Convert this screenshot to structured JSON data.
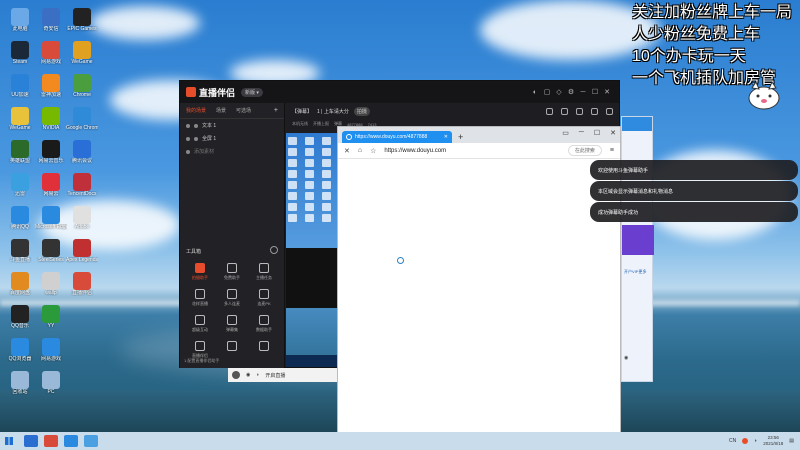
{
  "overlay": {
    "lines": [
      "关注加粉丝牌上车一局",
      "人少粉丝免费上车",
      "10个办卡玩一天",
      "一个飞机插队加房管"
    ]
  },
  "app": {
    "name": "直播伴侣",
    "version": "新版 ▾",
    "tabs": [
      "我的场景",
      "场景",
      "可选场"
    ],
    "plus": "+",
    "scenes": [
      "文本 1",
      "全屏 1",
      "添加素材"
    ],
    "tools_title": "工具箱",
    "tools": [
      "拍摄助手",
      "免费助手",
      "主播任务",
      "花样直播",
      "多人连麦",
      "连麦PK",
      "超级互动",
      "弹幕集",
      "数据助手",
      "直播伴侣",
      "",
      ""
    ],
    "bottom_note": "1.配置直播伴侣助手",
    "room_tag": "【弹幕】",
    "room_title": "1 | 上车请大分",
    "room_badge": "拍摄",
    "room_sub": [
      "本机无线",
      "开播上报",
      "弹幕",
      "4877888",
      "7413"
    ],
    "bottom_bar": "开启直播"
  },
  "browser": {
    "tab_title": "https://www.douyu.com/4877888",
    "tab_close": "✕",
    "new_tab": "+",
    "url": "https://www.douyu.com",
    "search_placeholder": "在此搜索",
    "window_controls": [
      "▭",
      "─",
      "☐",
      "✕"
    ],
    "nav_icons": [
      "✕",
      "⌂",
      "☆"
    ]
  },
  "chat": {
    "link_text": "开户VIP更多",
    "bottom": "◉"
  },
  "notifications": [
    "欢迎使用斗鱼弹幕助手",
    "本区域会显示弹幕消息和礼物消息",
    "成功弹幕助手成功"
  ],
  "taskbar": {
    "lang": "CN",
    "time": "23:56",
    "date": "2021/8/18"
  },
  "desktop_icons": [
    {
      "label": "此电脑",
      "color": "#6aa8e8"
    },
    {
      "label": "奇安信",
      "color": "#3b6fc4"
    },
    {
      "label": "EPIC Games",
      "color": "#222222"
    },
    {
      "label": "Steam",
      "color": "#1b2838"
    },
    {
      "label": "网易游戏",
      "color": "#d84b3a"
    },
    {
      "label": "WeGame",
      "color": "#e0a020"
    },
    {
      "label": "UU加速",
      "color": "#2a82d8"
    },
    {
      "label": "雷神加速",
      "color": "#f28a20"
    },
    {
      "label": "Chrome",
      "color": "#4a9e3e"
    },
    {
      "label": "WeGame",
      "color": "#e8c23a"
    },
    {
      "label": "NVIDIA",
      "color": "#76b900"
    },
    {
      "label": "Google Chrome",
      "color": "#2f8ad8"
    },
    {
      "label": "英雄联盟",
      "color": "#2c6a2a"
    },
    {
      "label": "网易云音乐",
      "color": "#1a1a1a"
    },
    {
      "label": "腾讯会议",
      "color": "#2a6fd8"
    },
    {
      "label": "迅雷",
      "color": "#3aa0e0"
    },
    {
      "label": "网易云",
      "color": "#e0303a"
    },
    {
      "label": "TencentDocs",
      "color": "#c0303a"
    },
    {
      "label": "腾讯QQ",
      "color": "#2a8ae0"
    },
    {
      "label": "Microsoft Edge",
      "color": "#2a8ae0"
    },
    {
      "label": "Adobe",
      "color": "#e0e0e0"
    },
    {
      "label": "斗鱼直播",
      "color": "#333333"
    },
    {
      "label": "SteelSeries",
      "color": "#333333"
    },
    {
      "label": "Apex Legends",
      "color": "#c03030"
    },
    {
      "label": "百度网盘",
      "color": "#e08a20"
    },
    {
      "label": "wallp",
      "color": "#d0d0d0"
    },
    {
      "label": "直播伴侣",
      "color": "#d84b3a"
    },
    {
      "label": "QQ音乐",
      "color": "#222222"
    },
    {
      "label": "YY",
      "color": "#2a9a3a"
    },
    {
      "label": "",
      "color": "transparent"
    },
    {
      "label": "QQ浏览器",
      "color": "#2a8ae0"
    },
    {
      "label": "网易游戏",
      "color": "#2a8ae0"
    },
    {
      "label": "",
      "color": "transparent"
    },
    {
      "label": "回收站",
      "color": "#9ab8d8"
    },
    {
      "label": "PC",
      "color": "#9ab8d8"
    }
  ]
}
